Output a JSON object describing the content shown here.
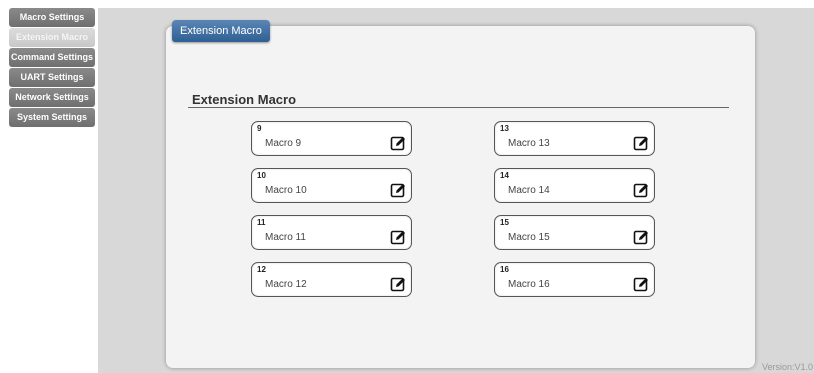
{
  "sidebar": {
    "items": [
      {
        "label": "Macro Settings"
      },
      {
        "label": "Extension Macro"
      },
      {
        "label": "Command Settings"
      },
      {
        "label": "UART Settings"
      },
      {
        "label": "Network Settings"
      },
      {
        "label": "System Settings"
      }
    ],
    "active_index": 1
  },
  "panel": {
    "tab_label": "Extension Macro",
    "section_title": "Extension Macro"
  },
  "macros": [
    {
      "number": "9",
      "name": "Macro 9"
    },
    {
      "number": "10",
      "name": "Macro 10"
    },
    {
      "number": "11",
      "name": "Macro 11"
    },
    {
      "number": "12",
      "name": "Macro 12"
    },
    {
      "number": "13",
      "name": "Macro 13"
    },
    {
      "number": "14",
      "name": "Macro 14"
    },
    {
      "number": "15",
      "name": "Macro 15"
    },
    {
      "number": "16",
      "name": "Macro 16"
    }
  ],
  "footer": {
    "version": "Version:V1.0"
  },
  "colors": {
    "tab_blue": "#3a6ea5",
    "sidebar_gray": "#7a7a7a",
    "background": "#d8d8d8"
  },
  "icons": {
    "edit": "edit-pencil-icon"
  }
}
